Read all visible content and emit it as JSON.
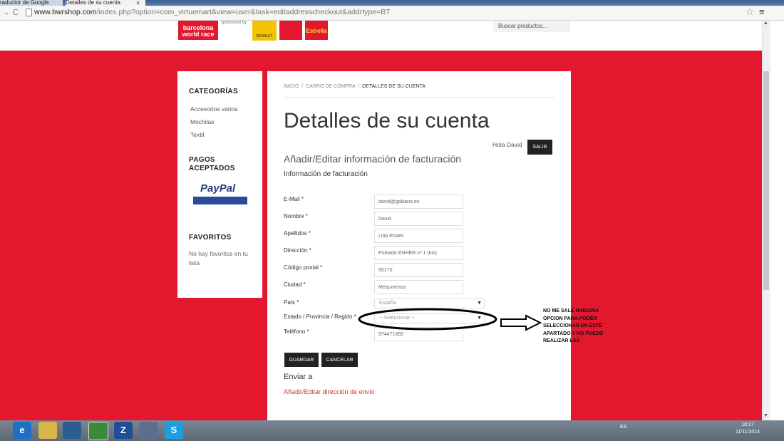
{
  "browser": {
    "tabs": [
      {
        "label": "raductor de Google"
      },
      {
        "label": "Detalles de su cuenta"
      }
    ],
    "tab_close": "×",
    "url_host": "www.bwrshop.com",
    "url_path": "/index.php?option=com_virtuemart&view=user&task=editaddresscheckout&addrtype=BT",
    "star_glyph": "☆",
    "menu_glyph": "≡",
    "nav_glyph": "→ C"
  },
  "header": {
    "logo_text": "barcelona world race",
    "sponsored_text": "sponsored by",
    "renault_text": "RENAULT",
    "estrella_text": "Estrella",
    "search_placeholder": "Buscar productos..."
  },
  "sidebar": {
    "categories_title": "CATEGORÍAS",
    "categories": [
      "Accesorios varios",
      "Mochilas",
      "Textil"
    ],
    "payments_title": "PAGOS ACEPTADOS",
    "paypal_text": "PayPal",
    "favorites_title": "FAVORITOS",
    "favorites_empty": "No hay favoritos en tu lista"
  },
  "breadcrumb": {
    "items": [
      "INICIO",
      "CARRO DE COMPRA",
      "DETALLES DE SU CUENTA"
    ],
    "separator": "/"
  },
  "page": {
    "title": "Detalles de su cuenta",
    "greeting": "Hola David",
    "logout_label": "SALIR",
    "section_title": "Añadir/Editar información de facturación",
    "billing_info": "Información de facturación"
  },
  "form": {
    "fields": [
      {
        "label": "E-Mail *",
        "value": "david@galliano.es"
      },
      {
        "label": "Nombre *",
        "value": "David"
      },
      {
        "label": "Apellidos *",
        "value": "Llop Rodes"
      },
      {
        "label": "Dirección *",
        "value": "Poblado ENHER nº 1 (bis)"
      },
      {
        "label": "Código postal *",
        "value": "50170"
      },
      {
        "label": "Ciudad *",
        "value": "Mequinenza"
      }
    ],
    "country_label": "País *",
    "country_value": "España",
    "state_label": "Estado / Provincia / Región *",
    "state_value": "-- Seleccionar --",
    "phone_label": "Teléfono *",
    "phone_value": "974471665",
    "save_label": "GUARDAR",
    "cancel_label": "CANCELAR",
    "ship_title": "Enviar a",
    "ship_link": "Añadir/Editar dirección de envío"
  },
  "annotation": {
    "note": "NO ME SALE NINGUNA OPCION PARA PODER SELECCIONAR EN ESTE APARTADO Y NO PUEDO REALIZAR LAS"
  },
  "taskbar": {
    "icons": [
      "e",
      "Z",
      "S"
    ],
    "lang": "ES",
    "time": "10:17",
    "date": "11/11/2014"
  },
  "colors": {
    "brand_red": "#e3172e",
    "button_dark": "#222222",
    "link_red": "#c0392b"
  }
}
